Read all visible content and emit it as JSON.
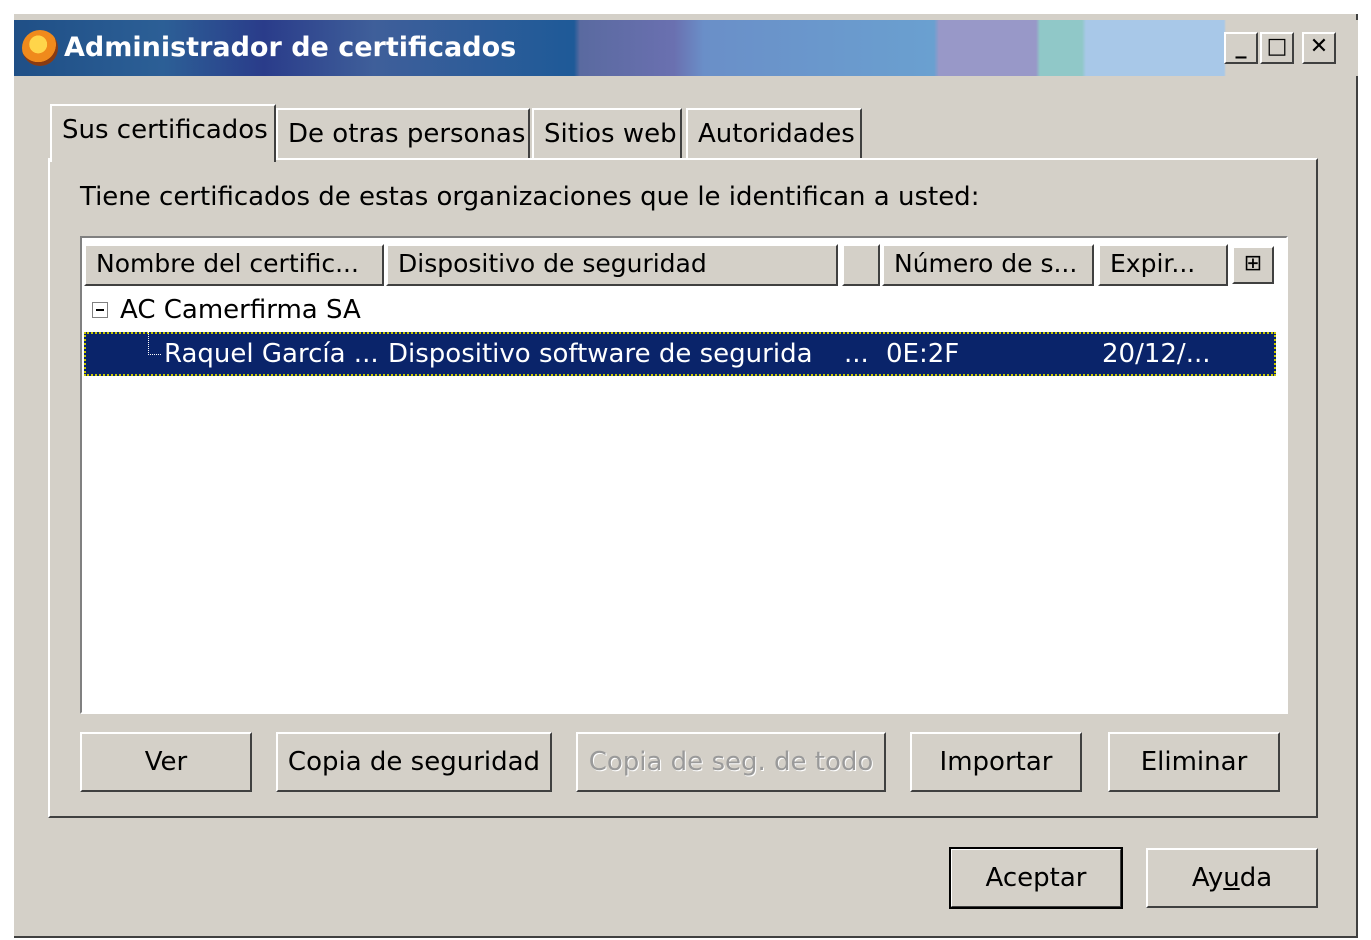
{
  "window": {
    "title": "Administrador de certificados",
    "controls": {
      "minimize": "_",
      "maximize": "□",
      "close": "✕"
    }
  },
  "tabs": [
    {
      "label": "Sus certificados",
      "active": true
    },
    {
      "label": "De otras personas",
      "active": false
    },
    {
      "label": "Sitios web",
      "active": false
    },
    {
      "label": "Autoridades",
      "active": false
    }
  ],
  "description": "Tiene certificados de estas organizaciones que le identifican a usted:",
  "table": {
    "columns": [
      "Nombre del certific...",
      "Dispositivo de seguridad",
      "",
      "Número de s...",
      "Expir..."
    ],
    "column_picker_icon": "column-picker-icon",
    "group": {
      "name": "AC Camerfirma SA",
      "expanded": true
    },
    "rows": [
      {
        "name": "Raquel García ...",
        "device": "Dispositivo software de segurida",
        "extra": "...",
        "serial": "0E:2F",
        "expires": "20/12/..."
      }
    ]
  },
  "buttons": {
    "view": "Ver",
    "backup": "Copia de seguridad",
    "backup_all": "Copia de seg. de todo",
    "import": "Importar",
    "delete": "Eliminar"
  },
  "footer": {
    "ok": "Aceptar",
    "help_prefix": "Ay",
    "help_accel": "u",
    "help_suffix": "da"
  }
}
